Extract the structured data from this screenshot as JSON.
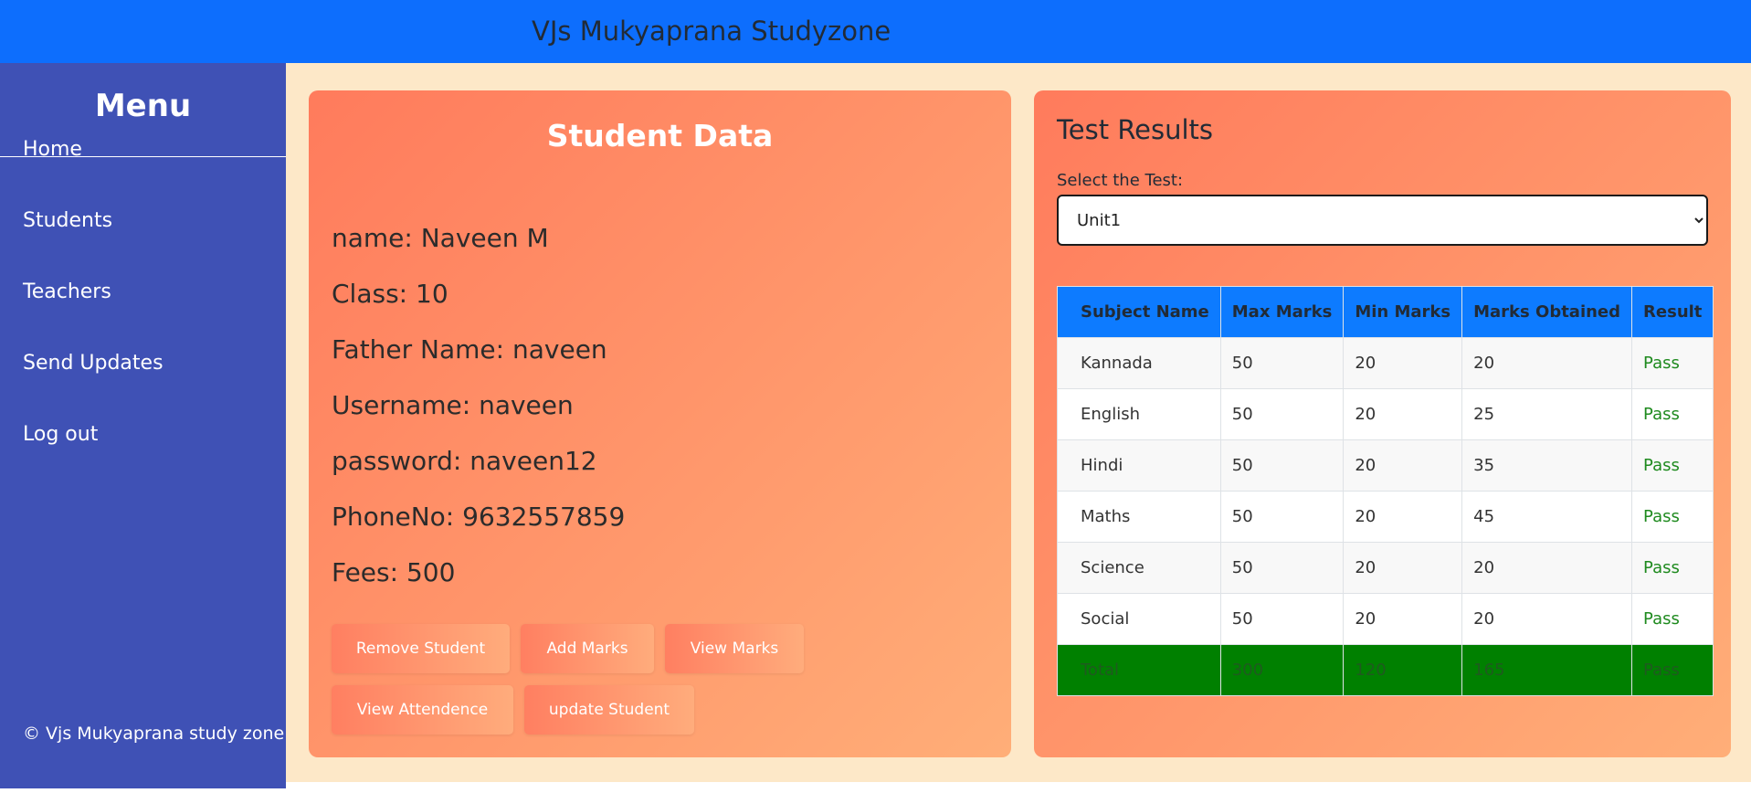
{
  "header": {
    "title": "VJs Mukyaprana Studyzone"
  },
  "sidebar": {
    "title": "Menu",
    "items": [
      {
        "label": "Home"
      },
      {
        "label": "Students"
      },
      {
        "label": "Teachers"
      },
      {
        "label": "Send Updates"
      },
      {
        "label": "Log out"
      }
    ],
    "footer": "© Vjs Mukyaprana study zone"
  },
  "student": {
    "title": "Student Data",
    "fields": [
      "name: Naveen M",
      "Class: 10",
      "Father Name: naveen",
      "Username: naveen",
      "password: naveen12",
      "PhoneNo: 9632557859",
      "Fees: 500"
    ],
    "buttons": {
      "remove": "Remove Student",
      "add_marks": "Add Marks",
      "view_marks": "View Marks",
      "view_attendance": "View Attendence",
      "update": "update Student"
    }
  },
  "results": {
    "title": "Test Results",
    "select_label": "Select the Test:",
    "selected_test": "Unit1",
    "columns": [
      "Subject Name",
      "Max Marks",
      "Min Marks",
      "Marks Obtained",
      "Result"
    ],
    "rows": [
      [
        "Kannada",
        "50",
        "20",
        "20",
        "Pass"
      ],
      [
        "English",
        "50",
        "20",
        "25",
        "Pass"
      ],
      [
        "Hindi",
        "50",
        "20",
        "35",
        "Pass"
      ],
      [
        "Maths",
        "50",
        "20",
        "45",
        "Pass"
      ],
      [
        "Science",
        "50",
        "20",
        "20",
        "Pass"
      ],
      [
        "Social",
        "50",
        "20",
        "20",
        "Pass"
      ]
    ],
    "total": [
      "Total",
      "300",
      "120",
      "165",
      "Pass"
    ]
  },
  "colors": {
    "header_blue": "#0d6efd",
    "sidebar_indigo": "#3f51b5",
    "card_gradient_start": "#ff7b5c",
    "card_gradient_end": "#ffae78",
    "pass_green": "#1e8a1e",
    "total_row_green": "#008000"
  },
  "icons": {
    "select_arrow": "chevron-down-icon"
  }
}
